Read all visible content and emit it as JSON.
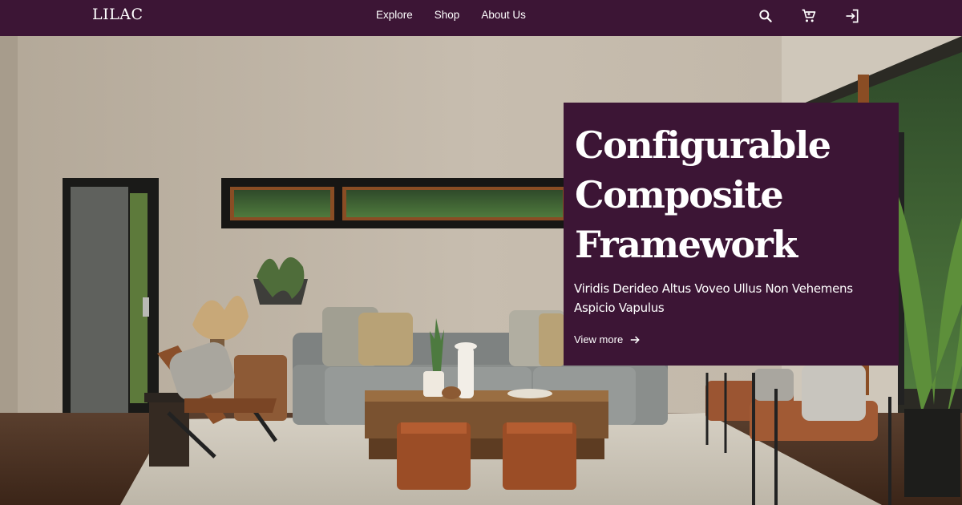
{
  "brand": {
    "logo": "LILAC"
  },
  "nav": {
    "items": [
      {
        "label": "Explore"
      },
      {
        "label": "Shop"
      },
      {
        "label": "About Us"
      }
    ]
  },
  "header_icons": [
    "search-icon",
    "cart-icon",
    "login-icon"
  ],
  "hero": {
    "image_subject": "living room interior with gray sofa, wooden coffee table, leather ottomans, plants and large windows",
    "promo": {
      "title": "Configurable Composite Framework",
      "subtitle": "Viridis Derideo Altus Voveo Ullus Non Vehemens Aspicio Vapulus",
      "link_label": "View more",
      "link_icon": "arrow-right-icon"
    }
  },
  "colors": {
    "brand": "#3c1535",
    "text_on_brand": "#ffffff"
  }
}
